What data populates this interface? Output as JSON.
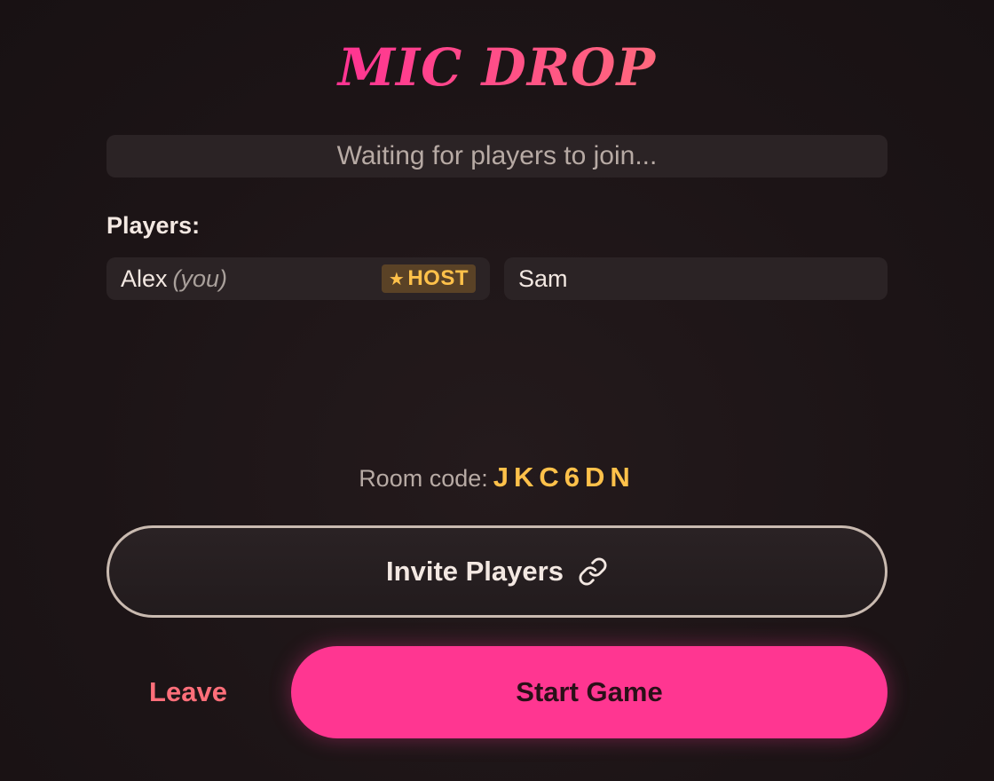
{
  "app": {
    "title": "MIC DROP"
  },
  "status": {
    "text": "Waiting for players to join..."
  },
  "players_section": {
    "heading": "Players:",
    "players": [
      {
        "name": "Alex",
        "tag": "(you)",
        "badge": "HOST",
        "badge_icon": "star-icon"
      },
      {
        "name": "Sam"
      }
    ]
  },
  "room": {
    "label": "Room code:",
    "code": "JKC6DN"
  },
  "actions": {
    "invite_label": "Invite Players",
    "invite_icon": "link-icon",
    "leave_label": "Leave",
    "start_label": "Start Game"
  },
  "colors": {
    "accent_pink": "#ff3691",
    "accent_coral": "#ff6f7a",
    "accent_gold": "#ffc14a",
    "background": "#1c1416",
    "card": "#2b2325"
  }
}
